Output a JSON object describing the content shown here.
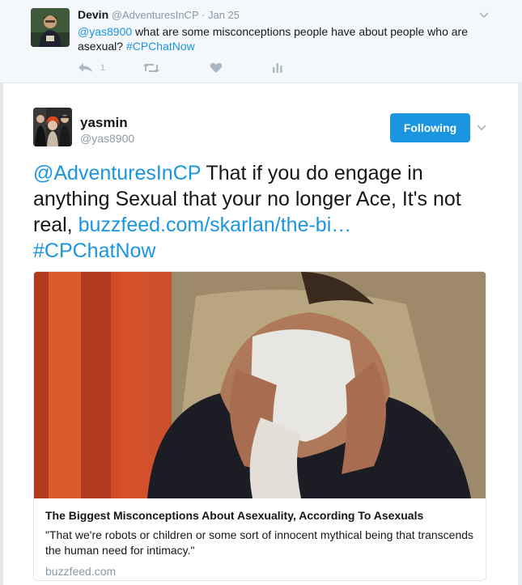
{
  "parent_tweet": {
    "name": "Devin",
    "handle": "@AdventuresInCP",
    "separator": "·",
    "date": "Jan 25",
    "mention": "@yas8900",
    "text": " what are some misconceptions people have about people who are asexual? ",
    "hashtag": "#CPChatNow",
    "reply_count": "1",
    "icons": [
      "reply-icon",
      "retweet-icon",
      "like-icon",
      "analytics-icon",
      "chevron-down-icon"
    ]
  },
  "main_tweet": {
    "name": "yasmin",
    "handle": "@yas8900",
    "follow_label": "Following",
    "mention": "@AdventuresInCP",
    "text": " That if you do engage in anything Sexual that your no longer Ace, It's not real,  ",
    "link": "buzzfeed.com/skarlan/the-bi…",
    "hashtag": "#CPChatNow"
  },
  "card": {
    "title": "The Biggest Misconceptions About Asexuality, According To Asexuals",
    "description": "\"That we're robots or children or some sort of innocent mythical being that transcends the human need for intimacy.\"",
    "domain": "buzzfeed.com"
  },
  "colors": {
    "link": "#1b95e0",
    "button": "#1b95e0",
    "muted": "#8899a6",
    "parent_bg": "#f5f8fa"
  }
}
